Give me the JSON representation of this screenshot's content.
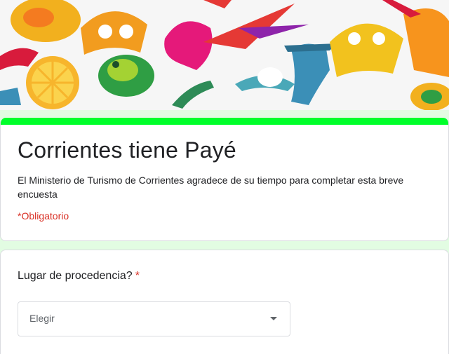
{
  "form": {
    "title": "Corrientes tiene Payé",
    "description": "El Ministerio de Turismo de Corrientes agradece de su tiempo para completar esta breve encuesta",
    "required_note": "*Obligatorio",
    "accent_color": "#00ff2a"
  },
  "question": {
    "label": "Lugar de procedencia?",
    "required_mark": "*",
    "select": {
      "value": "Elegir"
    }
  },
  "icons": {
    "dropdown": "caret-down-icon"
  }
}
